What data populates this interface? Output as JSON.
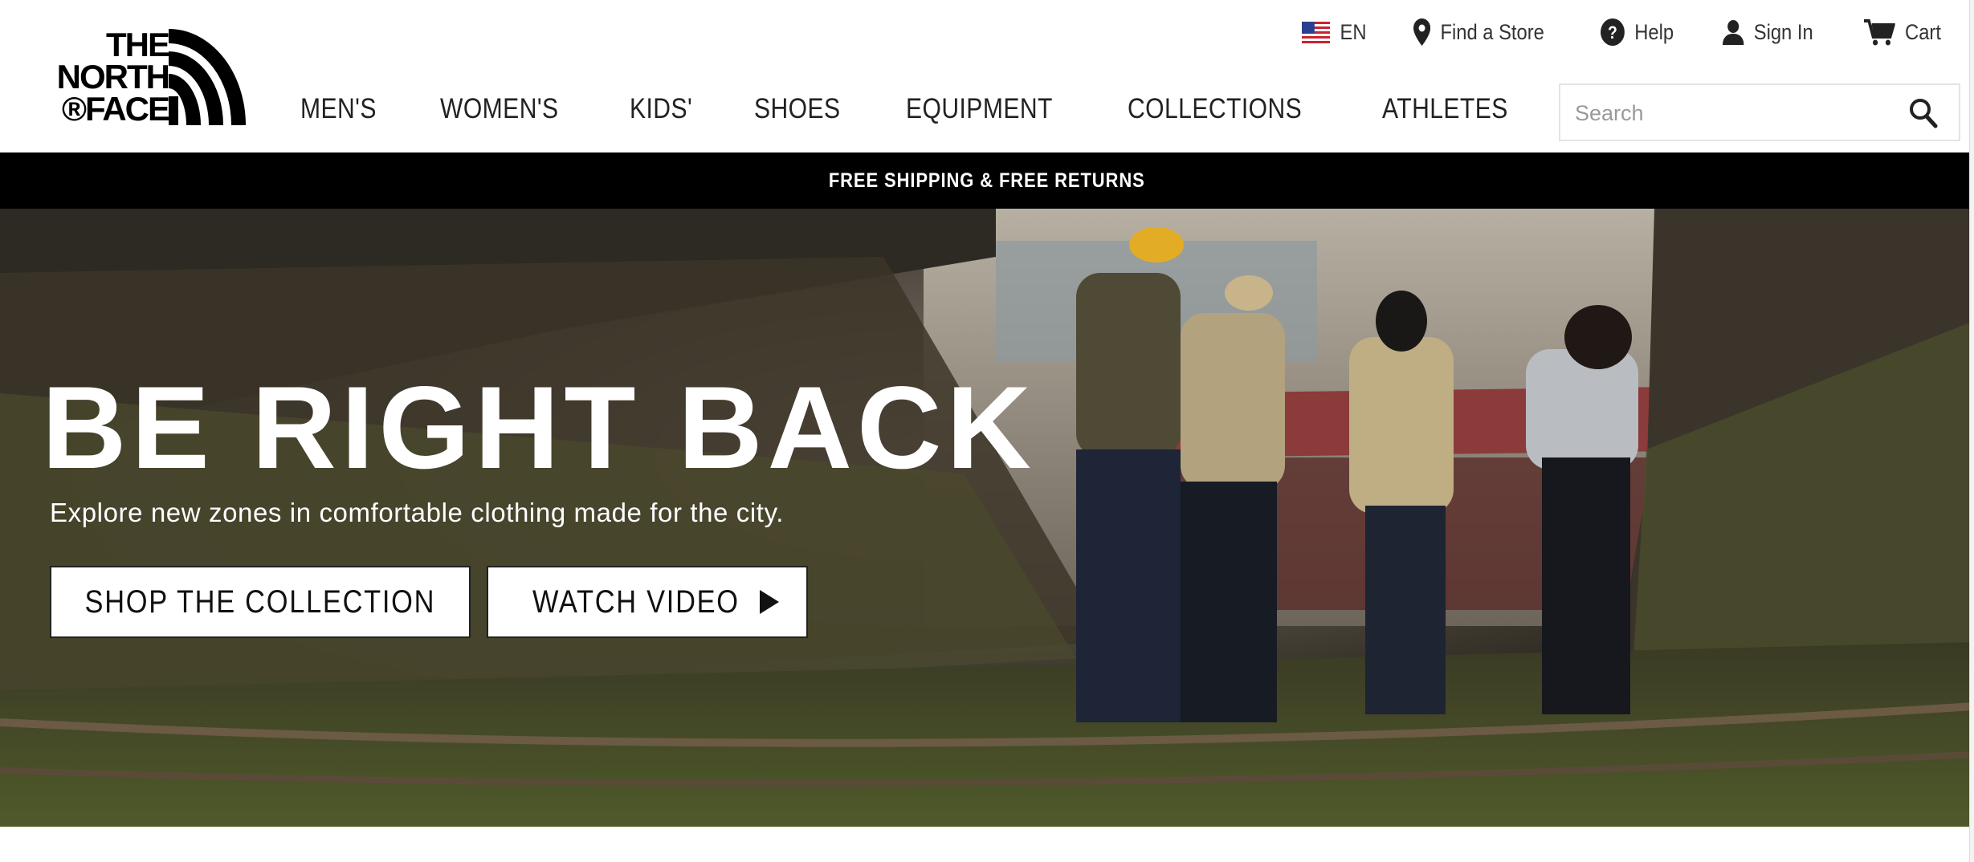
{
  "brand": {
    "logo_lines": [
      "THE",
      "NORTH",
      "®FACE"
    ]
  },
  "utility": {
    "language": "EN",
    "find_store": "Find a Store",
    "help": "Help",
    "sign_in": "Sign In",
    "cart": "Cart"
  },
  "nav": {
    "items": [
      "MEN'S",
      "WOMEN'S",
      "KIDS'",
      "SHOES",
      "EQUIPMENT",
      "COLLECTIONS",
      "ATHLETES"
    ]
  },
  "search": {
    "placeholder": "Search",
    "value": ""
  },
  "promo": {
    "text": "FREE SHIPPING & FREE RETURNS"
  },
  "hero": {
    "title": "BE RIGHT BACK",
    "subtitle": "Explore new zones in comfortable clothing made for the city.",
    "primary_button": "SHOP THE COLLECTION",
    "secondary_button": "WATCH VIDEO"
  },
  "colors": {
    "promo_bg": "#000000",
    "text_dark": "#222222",
    "hero_text": "#ffffff"
  },
  "icons": {
    "flag": "us-flag-icon",
    "store": "location-pin-icon",
    "help": "question-circle-icon",
    "user": "user-icon",
    "cart": "cart-icon",
    "search": "search-icon",
    "play": "play-icon"
  }
}
